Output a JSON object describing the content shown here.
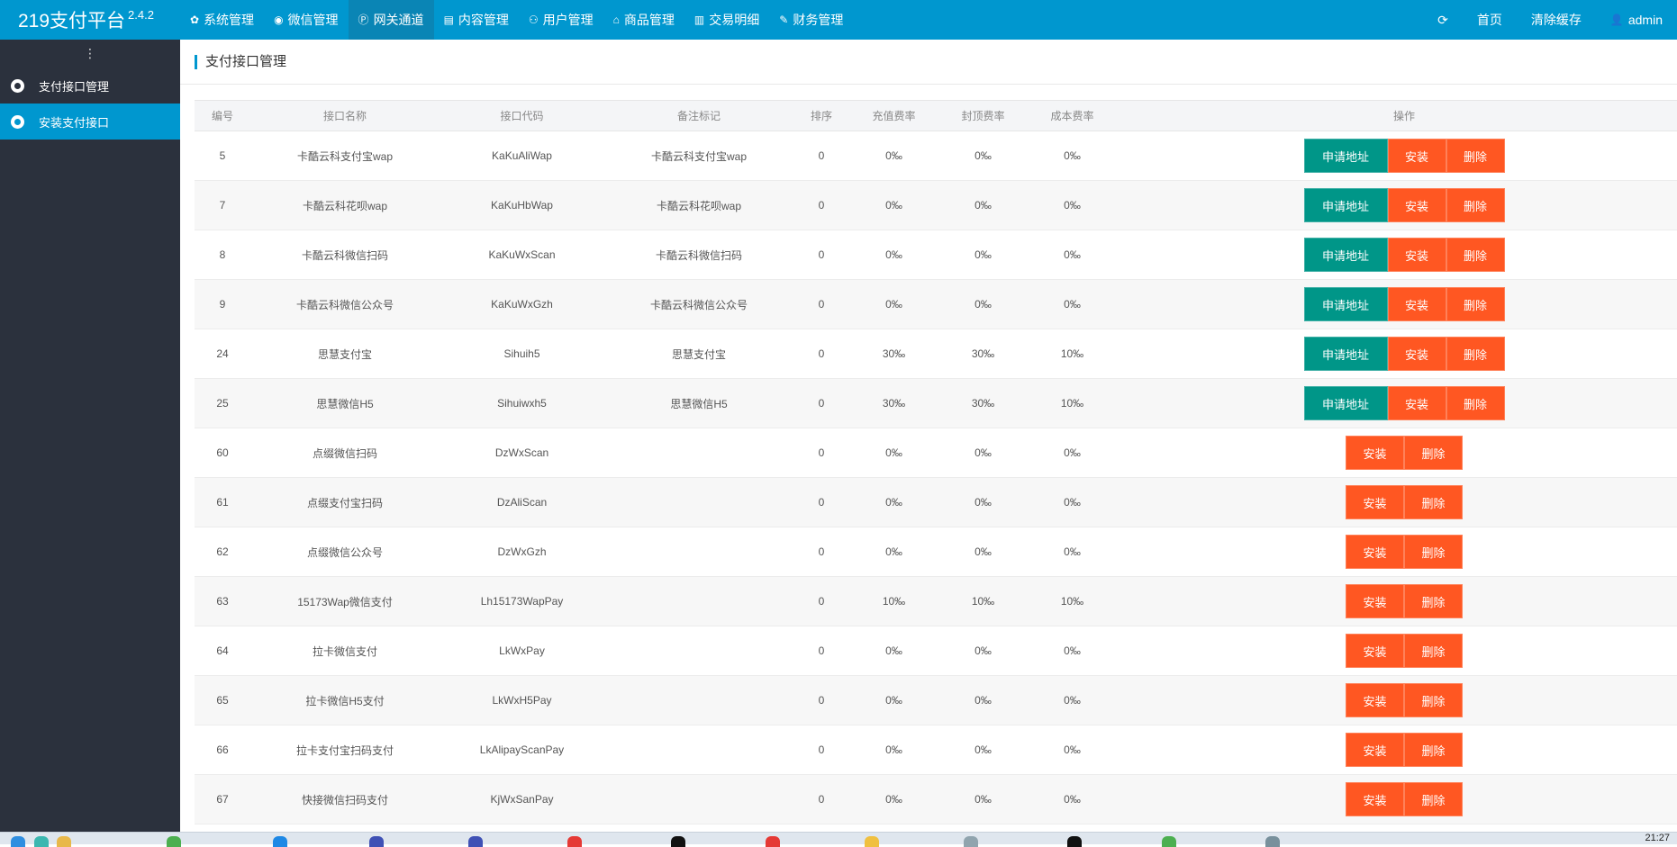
{
  "app": {
    "name": "219支付平台",
    "version": "2.4.2"
  },
  "nav": [
    {
      "label": "系统管理",
      "icon": "✿",
      "active": false
    },
    {
      "label": "微信管理",
      "icon": "◉",
      "active": false
    },
    {
      "label": "网关通道",
      "icon": "Ⓟ",
      "active": true
    },
    {
      "label": "内容管理",
      "icon": "▤",
      "active": false
    },
    {
      "label": "用户管理",
      "icon": "⚇",
      "active": false
    },
    {
      "label": "商品管理",
      "icon": "⌂",
      "active": false
    },
    {
      "label": "交易明细",
      "icon": "▥",
      "active": false
    },
    {
      "label": "财务管理",
      "icon": "✎",
      "active": false
    }
  ],
  "topright": {
    "refresh_icon": "⟳",
    "home": "首页",
    "clear_cache": "清除缓存",
    "user_icon": "👤",
    "user": "admin"
  },
  "sidebar": {
    "toggle": "⋮",
    "items": [
      {
        "label": "支付接口管理",
        "active": false
      },
      {
        "label": "安装支付接口",
        "active": true
      }
    ]
  },
  "page": {
    "title": "支付接口管理"
  },
  "table": {
    "columns": [
      "编号",
      "接口名称",
      "接口代码",
      "备注标记",
      "排序",
      "充值费率",
      "封顶费率",
      "成本费率",
      "操作"
    ],
    "buttons": {
      "apply": "申请地址",
      "install": "安装",
      "delete": "删除"
    },
    "rows": [
      {
        "id": "5",
        "name": "卡酷云科支付宝wap",
        "code": "KaKuAliWap",
        "remark": "卡酷云科支付宝wap",
        "sort": "0",
        "rate": "0‰",
        "cap": "0‰",
        "cost": "0‰",
        "apply": true
      },
      {
        "id": "7",
        "name": "卡酷云科花呗wap",
        "code": "KaKuHbWap",
        "remark": "卡酷云科花呗wap",
        "sort": "0",
        "rate": "0‰",
        "cap": "0‰",
        "cost": "0‰",
        "apply": true
      },
      {
        "id": "8",
        "name": "卡酷云科微信扫码",
        "code": "KaKuWxScan",
        "remark": "卡酷云科微信扫码",
        "sort": "0",
        "rate": "0‰",
        "cap": "0‰",
        "cost": "0‰",
        "apply": true
      },
      {
        "id": "9",
        "name": "卡酷云科微信公众号",
        "code": "KaKuWxGzh",
        "remark": "卡酷云科微信公众号",
        "sort": "0",
        "rate": "0‰",
        "cap": "0‰",
        "cost": "0‰",
        "apply": true
      },
      {
        "id": "24",
        "name": "思慧支付宝",
        "code": "Sihuih5",
        "remark": "思慧支付宝",
        "sort": "0",
        "rate": "30‰",
        "cap": "30‰",
        "cost": "10‰",
        "apply": true
      },
      {
        "id": "25",
        "name": "思慧微信H5",
        "code": "Sihuiwxh5",
        "remark": "思慧微信H5",
        "sort": "0",
        "rate": "30‰",
        "cap": "30‰",
        "cost": "10‰",
        "apply": true
      },
      {
        "id": "60",
        "name": "点缀微信扫码",
        "code": "DzWxScan",
        "remark": "",
        "sort": "0",
        "rate": "0‰",
        "cap": "0‰",
        "cost": "0‰",
        "apply": false
      },
      {
        "id": "61",
        "name": "点缀支付宝扫码",
        "code": "DzAliScan",
        "remark": "",
        "sort": "0",
        "rate": "0‰",
        "cap": "0‰",
        "cost": "0‰",
        "apply": false
      },
      {
        "id": "62",
        "name": "点缀微信公众号",
        "code": "DzWxGzh",
        "remark": "",
        "sort": "0",
        "rate": "0‰",
        "cap": "0‰",
        "cost": "0‰",
        "apply": false
      },
      {
        "id": "63",
        "name": "15173Wap微信支付",
        "code": "Lh15173WapPay",
        "remark": "",
        "sort": "0",
        "rate": "10‰",
        "cap": "10‰",
        "cost": "10‰",
        "apply": false
      },
      {
        "id": "64",
        "name": "拉卡微信支付",
        "code": "LkWxPay",
        "remark": "",
        "sort": "0",
        "rate": "0‰",
        "cap": "0‰",
        "cost": "0‰",
        "apply": false
      },
      {
        "id": "65",
        "name": "拉卡微信H5支付",
        "code": "LkWxH5Pay",
        "remark": "",
        "sort": "0",
        "rate": "0‰",
        "cap": "0‰",
        "cost": "0‰",
        "apply": false
      },
      {
        "id": "66",
        "name": "拉卡支付宝扫码支付",
        "code": "LkAlipayScanPay",
        "remark": "",
        "sort": "0",
        "rate": "0‰",
        "cap": "0‰",
        "cost": "0‰",
        "apply": false
      },
      {
        "id": "67",
        "name": "快接微信扫码支付",
        "code": "KjWxSanPay",
        "remark": "",
        "sort": "0",
        "rate": "0‰",
        "cap": "0‰",
        "cost": "0‰",
        "apply": false
      }
    ]
  },
  "taskbar": {
    "clock": "21:27",
    "icons": [
      {
        "name": "windows-start-icon",
        "color": "#2f8ee0"
      },
      {
        "name": "browser-icon",
        "color": "#3bb7b0"
      },
      {
        "name": "folder-icon",
        "color": "#e8b84a"
      },
      {
        "name": "app-icon",
        "color": "#4caf50"
      },
      {
        "name": "app-icon",
        "color": "#1e88e5"
      },
      {
        "name": "app-icon",
        "color": "#3f51b5"
      },
      {
        "name": "app-icon",
        "color": "#3f51b5"
      },
      {
        "name": "app-icon",
        "color": "#e53935"
      },
      {
        "name": "app-icon",
        "color": "#111111"
      },
      {
        "name": "app-icon",
        "color": "#e53935"
      },
      {
        "name": "app-icon",
        "color": "#f0c040"
      },
      {
        "name": "app-icon",
        "color": "#90a4ae"
      },
      {
        "name": "app-icon",
        "color": "#111111"
      },
      {
        "name": "app-icon",
        "color": "#4caf50"
      },
      {
        "name": "app-icon",
        "color": "#78909c"
      }
    ]
  }
}
